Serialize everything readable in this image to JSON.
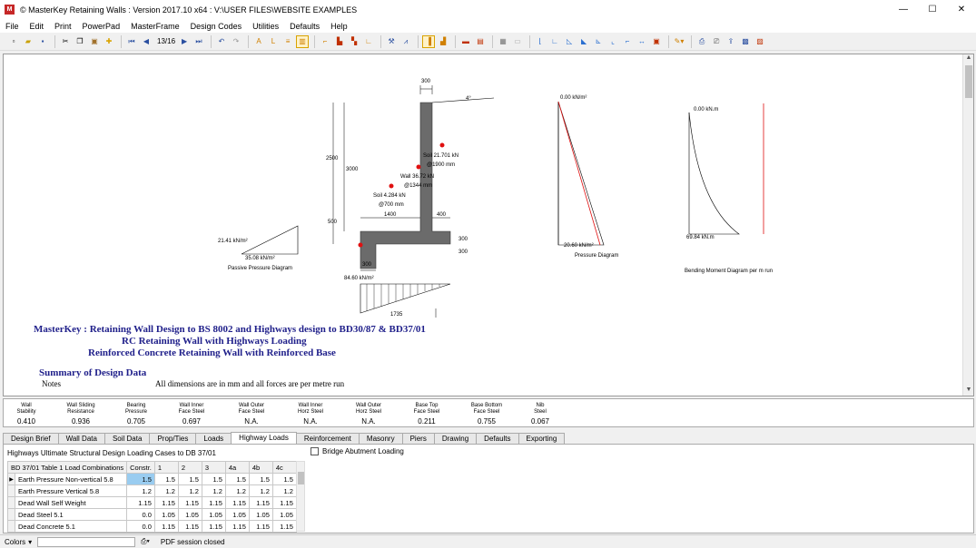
{
  "window": {
    "title": "© MasterKey Retaining Walls : Version 2017.10 x64 : V:\\USER FILES\\WEBSITE EXAMPLES",
    "minimize": "—",
    "maximize": "☐",
    "close": "✕"
  },
  "menu": [
    "File",
    "Edit",
    "Print",
    "PowerPad",
    "MasterFrame",
    "Design Codes",
    "Utilities",
    "Defaults",
    "Help"
  ],
  "toolbar": {
    "page_indicator": "13/16",
    "icons": [
      "new-icon",
      "open-icon",
      "save-icon",
      "cut-icon",
      "copy-icon",
      "paste-icon",
      "add-icon",
      "first-page-icon",
      "prev-page-icon",
      "next-page-icon",
      "last-page-icon",
      "undo-icon",
      "redo-icon",
      "wall-type-icon",
      "print-icon",
      "preview-icon"
    ]
  },
  "drawing": {
    "dims": {
      "top_width": "300",
      "slope": "4°",
      "h_2500": "2500",
      "h_3000": "3000",
      "h_500": "500",
      "base_1400": "1400",
      "base_400": "400",
      "base_300_r1": "300",
      "base_300_r2": "300",
      "base_300_b": "300",
      "base_len": "1735"
    },
    "loads": {
      "soil_top_1": "Soil 21.701 kN",
      "soil_top_2": "@1900 mm",
      "wall_1": "Wall 36.72 kN",
      "wall_2": "@1344 mm",
      "soil_bot_1": "Soil 4.284 kN",
      "soil_bot_2": "@700 mm"
    },
    "passive": {
      "top_label": "21.41 kN/m²",
      "bot_label": "35.08 kN/m²",
      "caption": "Passive Pressure Diagram"
    },
    "base_pressure": "84.60 kN/m²",
    "pressure": {
      "top_label": "0.00 kN/m²",
      "bot_label": "20.60 kN/m²",
      "caption": "Pressure Diagram"
    },
    "bending": {
      "top_label": "0.00 kN.m",
      "bot_label": "69.84 kN.m",
      "caption": "Bending Moment Diagram per m run"
    }
  },
  "report": {
    "line1": "MasterKey : Retaining Wall Design to BS 8002 and Highways design to BD30/87 & BD37/01",
    "line2": "RC Retaining Wall with Highways Loading",
    "line3": "Reinforced Concrete Retaining Wall with Reinforced  Base",
    "summary_title": "Summary of Design Data",
    "notes_label": "Notes",
    "notes_text": "All dimensions are in mm and all forces are per metre run"
  },
  "results": [
    {
      "head": "Wall\nStability",
      "value": "0.410"
    },
    {
      "head": "Wall Sliding\nResistance",
      "value": "0.936"
    },
    {
      "head": "Bearing\nPressure",
      "value": "0.705"
    },
    {
      "head": "Wall Inner\nFace Steel",
      "value": "0.697"
    },
    {
      "head": "Wall Outer\nFace Steel",
      "value": "N.A."
    },
    {
      "head": "Wall Inner\nHorz Steel",
      "value": "N.A."
    },
    {
      "head": "Wall Outer\nHorz Steel",
      "value": "N.A."
    },
    {
      "head": "Base Top\nFace Steel",
      "value": "0.211"
    },
    {
      "head": "Base Bottom\nFace Steel",
      "value": "0.755"
    },
    {
      "head": "Nib\nSteel",
      "value": "0.067"
    }
  ],
  "tabs": [
    "Design Brief",
    "Wall Data",
    "Soil Data",
    "Prop/Ties",
    "Loads",
    "Highway Loads",
    "Reinforcement",
    "Masonry",
    "Piers",
    "Drawing",
    "Defaults",
    "Exporting"
  ],
  "active_tab": "Highway Loads",
  "panel": {
    "title": "Highways Ultimate Structural Design Loading Cases to DB 37/01",
    "checkbox_label": "Bridge Abutment Loading",
    "headers": [
      "BD 37/01 Table 1 Load Combinations",
      "Constr.",
      "1",
      "2",
      "3",
      "4a",
      "4b",
      "4c"
    ],
    "rows": [
      {
        "label": "Earth Pressure Non-vertical 5.8",
        "values": [
          "1.5",
          "1.5",
          "1.5",
          "1.5",
          "1.5",
          "1.5",
          "1.5"
        ]
      },
      {
        "label": "Earth Pressure Vertical 5.8",
        "values": [
          "1.2",
          "1.2",
          "1.2",
          "1.2",
          "1.2",
          "1.2",
          "1.2"
        ]
      },
      {
        "label": "Dead Wall Self Weight",
        "values": [
          "1.15",
          "1.15",
          "1.15",
          "1.15",
          "1.15",
          "1.15",
          "1.15"
        ]
      },
      {
        "label": "Dead Steel 5.1",
        "values": [
          "0.0",
          "1.05",
          "1.05",
          "1.05",
          "1.05",
          "1.05",
          "1.05"
        ]
      },
      {
        "label": "Dead Concrete 5.1",
        "values": [
          "0.0",
          "1.15",
          "1.15",
          "1.15",
          "1.15",
          "1.15",
          "1.15"
        ]
      }
    ]
  },
  "status": {
    "colors_label": "Colors",
    "session_text": "PDF session closed"
  }
}
